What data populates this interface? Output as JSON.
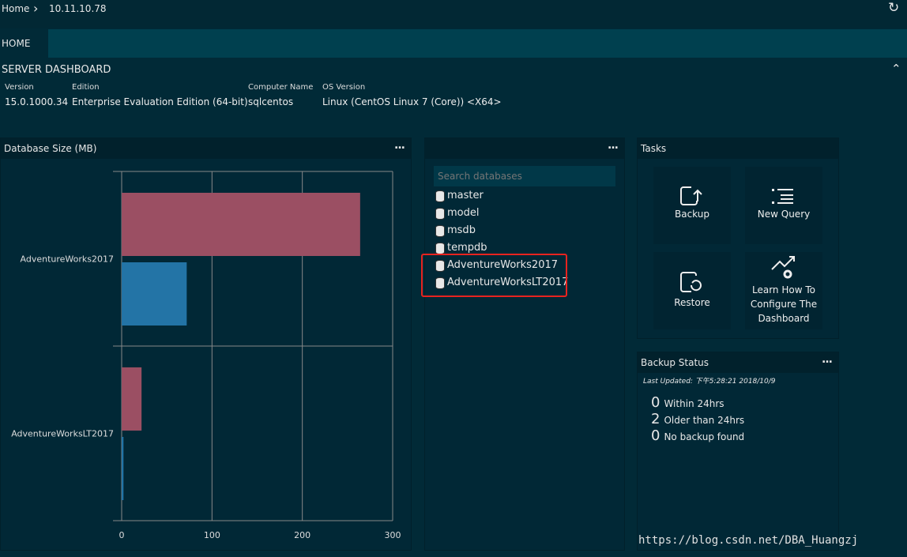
{
  "breadcrumb": {
    "home": "Home",
    "server": "10.11.10.78"
  },
  "tabs": [
    {
      "label": "HOME"
    }
  ],
  "dashboard": {
    "title": "SERVER DASHBOARD",
    "props": [
      {
        "label": "Version",
        "value": "15.0.1000.34"
      },
      {
        "label": "Edition",
        "value": "Enterprise Evaluation Edition (64-bit)"
      },
      {
        "label": "Computer Name",
        "value": "sqlcentos"
      },
      {
        "label": "OS Version",
        "value": "Linux (CentOS Linux 7 (Core)) <X64>"
      }
    ]
  },
  "dbsize": {
    "title": "Database Size (MB)",
    "more": "..."
  },
  "chart_data": {
    "type": "bar",
    "orientation": "horizontal",
    "title": "Database Size (MB)",
    "categories": [
      "AdventureWorks2017",
      "AdventureWorksLT2017"
    ],
    "series": [
      {
        "values": [
          264,
          22
        ],
        "color": "#9b4f63"
      },
      {
        "values": [
          72,
          2
        ],
        "color": "#2374a6"
      }
    ],
    "xlim": [
      0,
      300
    ],
    "xticks": [
      "0",
      "100",
      "200",
      "300"
    ],
    "grid": true
  },
  "databases": {
    "more": "...",
    "search_placeholder": "Search databases",
    "items": [
      "master",
      "model",
      "msdb",
      "tempdb",
      "AdventureWorks2017",
      "AdventureWorksLT2017"
    ],
    "highlight_color": "#e8231f"
  },
  "tasks": {
    "title": "Tasks",
    "items": [
      {
        "label": "Backup",
        "icon": "backup-icon"
      },
      {
        "label": "New Query",
        "icon": "new-query-icon"
      },
      {
        "label": "Restore",
        "icon": "restore-icon"
      },
      {
        "label": "Learn How To Configure The Dashboard",
        "icon": "configure-dashboard-icon"
      }
    ]
  },
  "backup": {
    "title": "Backup Status",
    "more": "...",
    "updated": "Last Updated: 下午5:28:21 2018/10/9",
    "rows": [
      {
        "count": "0",
        "label": "Within 24hrs"
      },
      {
        "count": "2",
        "label": "Older than 24hrs"
      },
      {
        "count": "0",
        "label": "No backup found"
      }
    ]
  },
  "watermark": "https://blog.csdn.net/DBA_Huangzj"
}
